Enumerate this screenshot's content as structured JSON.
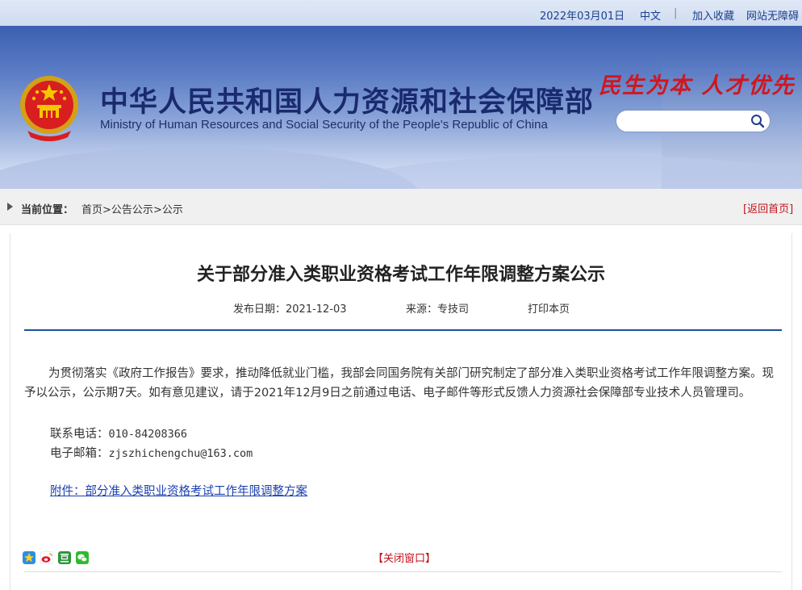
{
  "topbar": {
    "date": "2022年03月01日",
    "lang": "中文",
    "separator": "|",
    "bookmark": "加入收藏",
    "accessibility": "网站无障碍"
  },
  "header": {
    "title_cn": "中华人民共和国人力资源和社会保障部",
    "title_en": "Ministry of Human Resources and Social Security of the People's Republic of China",
    "slogan": "民生为本 人才优先",
    "search_placeholder": ""
  },
  "breadcrumb": {
    "label": "当前位置：",
    "items": [
      "首页",
      ">",
      "公告公示",
      ">",
      "公示"
    ],
    "back_home": "[返回首页]"
  },
  "article": {
    "title": "关于部分准入类职业资格考试工作年限调整方案公示",
    "publish_date": "发布日期：2021-12-03",
    "source": "来源：专技司",
    "print": "打印本页",
    "paragraph": "为贯彻落实《政府工作报告》要求，推动降低就业门槛，我部会同国务院有关部门研究制定了部分准入类职业资格考试工作年限调整方案。现予以公示，公示期7天。如有意见建议，请于2021年12月9日之前通过电话、电子邮件等形式反馈人力资源社会保障部专业技术人员管理司。",
    "phone_label": "联系电话：",
    "phone": "010-84208366",
    "email_label": "电子邮箱：",
    "email": "zjszhichengchu@163.com",
    "attachment": "附件：部分准入类职业资格考试工作年限调整方案"
  },
  "footer": {
    "close_window": "【关闭窗口】",
    "share_icons": [
      "qzone-icon",
      "weibo-icon",
      "douban-icon",
      "wechat-icon"
    ]
  },
  "colors": {
    "brand_blue": "#1f4f9c",
    "link_blue": "#1a3fb0",
    "accent_red": "#c1121a"
  }
}
